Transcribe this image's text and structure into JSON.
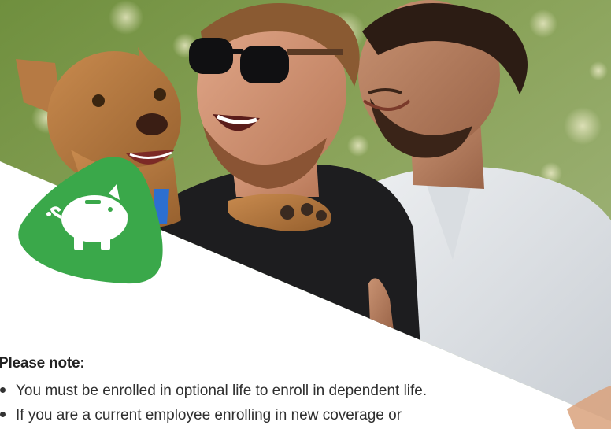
{
  "hero": {
    "image_description_icon": "photo-two-men-with-dog"
  },
  "badge": {
    "icon": "piggy-bank-icon",
    "color": "#3aa84a"
  },
  "note": {
    "heading": "Please note:",
    "items": [
      "You must be enrolled in optional life to enroll in dependent life.",
      "If you are a current employee enrolling in new coverage or"
    ]
  }
}
